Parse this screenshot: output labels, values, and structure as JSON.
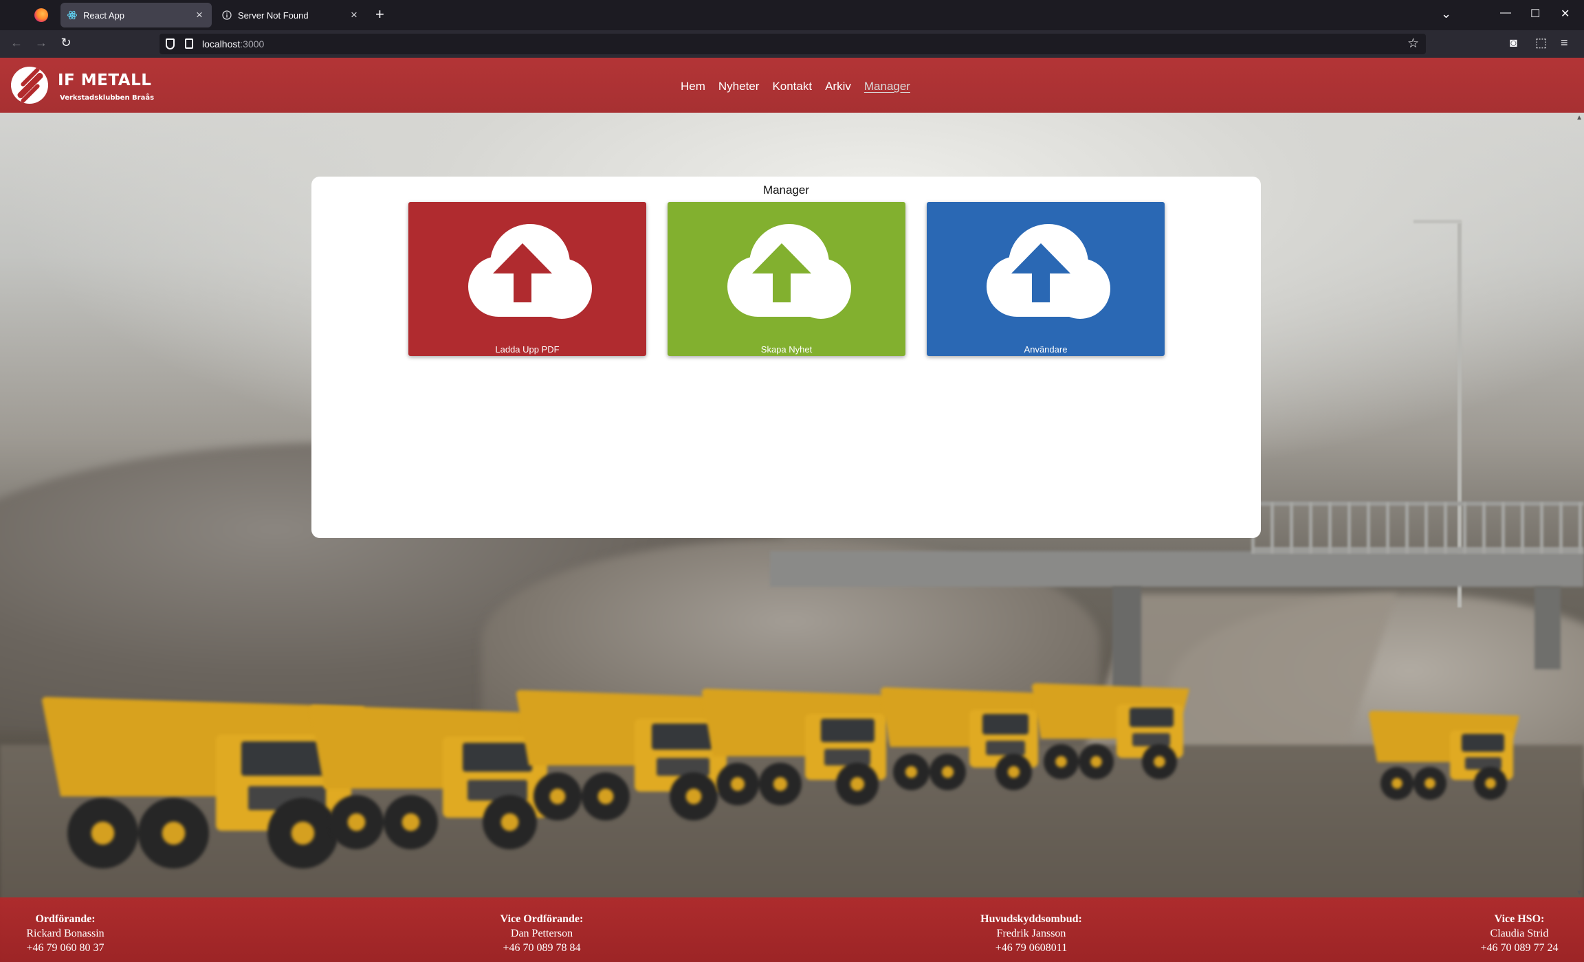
{
  "browser": {
    "tabs": [
      {
        "label": "React App",
        "icon": "react-icon",
        "active": true
      },
      {
        "label": "Server Not Found",
        "icon": "info-icon",
        "active": false
      }
    ],
    "url_host": "localhost",
    "url_port": ":3000"
  },
  "header": {
    "brand": "IF METALL",
    "subtitle": "Verkstadsklubben Braås",
    "nav": [
      "Hem",
      "Nyheter",
      "Kontakt",
      "Arkiv",
      "Manager"
    ],
    "current_nav": "Manager"
  },
  "manager": {
    "title": "Manager",
    "cards": [
      {
        "label": "Ladda Upp PDF",
        "color": "#b02b2f",
        "icon": "cloud-upload-icon"
      },
      {
        "label": "Skapa Nyhet",
        "color": "#82b02f",
        "icon": "cloud-upload-icon"
      },
      {
        "label": "Användare",
        "color": "#2a68b4",
        "icon": "cloud-upload-icon"
      }
    ]
  },
  "footer": {
    "contacts": [
      {
        "role": "Ordförande:",
        "name": "Rickard Bonassin",
        "phone": "+46 79 060 80 37"
      },
      {
        "role": "Vice Ordförande:",
        "name": "Dan Petterson",
        "phone": "+46 70 089 78 84"
      },
      {
        "role": "Huvudskyddsombud:",
        "name": "Fredrik Jansson",
        "phone": "+46 79 0608011"
      },
      {
        "role": "Vice HSO:",
        "name": "Claudia Strid",
        "phone": "+46 70 089 77 24"
      }
    ]
  },
  "colors": {
    "brand_red": "#b02b2f",
    "green": "#82b02f",
    "blue": "#2a68b4"
  }
}
